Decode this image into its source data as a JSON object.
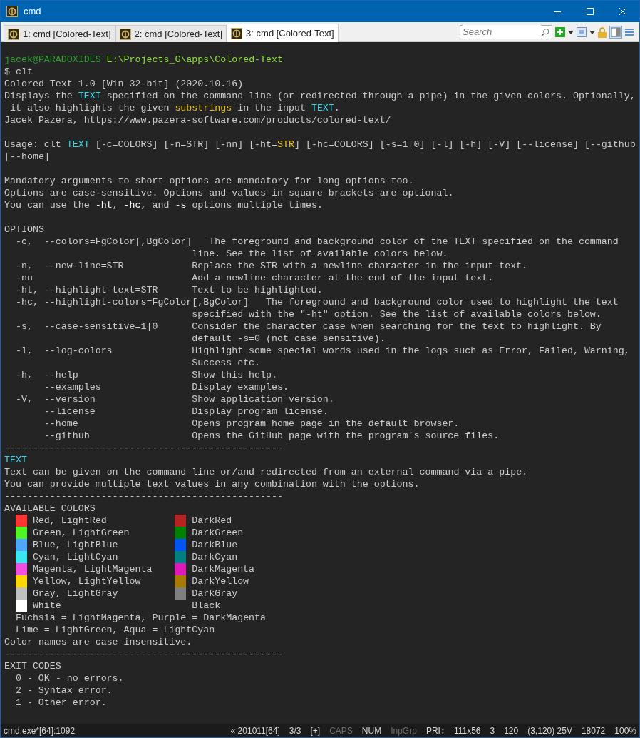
{
  "window": {
    "title": "cmd"
  },
  "tabs": [
    {
      "label": "1: cmd [Colored-Text]",
      "selected": false
    },
    {
      "label": "2: cmd [Colored-Text]",
      "selected": false
    },
    {
      "label": "3: cmd [Colored-Text]",
      "selected": true
    }
  ],
  "search": {
    "placeholder": "Search"
  },
  "console": {
    "lines": [
      {
        "kind": "prompt",
        "user": "jacek@PARADOXIDES",
        "path": "E:\\Projects_G\\apps\\Colored-Text"
      },
      {
        "kind": "text",
        "segments": [
          {
            "text": "$ clt"
          }
        ]
      },
      {
        "kind": "text",
        "segments": [
          {
            "text": "Colored Text 1.0 [Win 32-bit] (2020.10.16)"
          }
        ]
      },
      {
        "kind": "text",
        "segments": [
          {
            "text": "Displays the "
          },
          {
            "text": "TEXT",
            "color": "#3ad6e8"
          },
          {
            "text": " specified on the command line (or redirected through a pipe) in the given colors. Optionally,"
          }
        ]
      },
      {
        "kind": "text",
        "segments": [
          {
            "text": " it also highlights the given "
          },
          {
            "text": "substrings",
            "color": "#e8c11a"
          },
          {
            "text": " in the input "
          },
          {
            "text": "TEXT",
            "color": "#3ad6e8"
          },
          {
            "text": "."
          }
        ]
      },
      {
        "kind": "text",
        "segments": [
          {
            "text": "Jacek Pazera, https://www.pazera-software.com/products/colored-text/"
          }
        ]
      },
      {
        "kind": "blank"
      },
      {
        "kind": "text",
        "segments": [
          {
            "text": "Usage: clt "
          },
          {
            "text": "TEXT",
            "color": "#3ad6e8"
          },
          {
            "text": " [-c=COLORS] [-n=STR] [-nn] [-ht="
          },
          {
            "text": "STR",
            "color": "#e8c11a"
          },
          {
            "text": "] [-hc=COLORS] [-s=1|0] [-l] [-h] [-V] [--license] [--github"
          }
        ]
      },
      {
        "kind": "text",
        "segments": [
          {
            "text": "[--home]"
          }
        ]
      },
      {
        "kind": "blank"
      },
      {
        "kind": "text",
        "segments": [
          {
            "text": "Mandatory arguments to short options are mandatory for long options too."
          }
        ]
      },
      {
        "kind": "text",
        "segments": [
          {
            "text": "Options are case-sensitive. Options and values in square brackets are optional."
          }
        ]
      },
      {
        "kind": "text",
        "segments": [
          {
            "text": "You can use the "
          },
          {
            "text": "-ht",
            "color": "#ffffff"
          },
          {
            "text": ", "
          },
          {
            "text": "-hc",
            "color": "#ffffff"
          },
          {
            "text": ", and "
          },
          {
            "text": "-s",
            "color": "#ffffff"
          },
          {
            "text": " options multiple times."
          }
        ]
      },
      {
        "kind": "blank"
      },
      {
        "kind": "text",
        "segments": [
          {
            "text": "OPTIONS"
          }
        ]
      },
      {
        "kind": "option",
        "short": "-c,",
        "long": "--colors=FgColor[,BgColor]",
        "description": [
          "The foreground and background color of the TEXT specified on the command",
          "line. See the list of available colors below."
        ]
      },
      {
        "kind": "option",
        "short": "-n,",
        "long": "--new-line=STR",
        "description": [
          "Replace the STR with a newline character in the input text."
        ]
      },
      {
        "kind": "option",
        "short": "-nn",
        "description": [
          "Add a newline character at the end of the input text."
        ]
      },
      {
        "kind": "option",
        "short": "-ht,",
        "long": "--highlight-text=STR",
        "description": [
          "Text to be highlighted."
        ]
      },
      {
        "kind": "option",
        "short": "-hc,",
        "long": "--highlight-colors=FgColor[,BgColor]",
        "description": [
          "The foreground and background color used to highlight the text",
          "specified with the \"-ht\" option. See the list of available colors below."
        ]
      },
      {
        "kind": "option",
        "short": "-s,",
        "long": "--case-sensitive=1|0",
        "description": [
          "Consider the character case when searching for the text to highlight. By",
          "default -s=0 (not case sensitive)."
        ]
      },
      {
        "kind": "option",
        "short": "-l,",
        "long": "--log-colors",
        "description": [
          "Highlight some special words used in the logs such as Error, Failed, Warning,",
          "Success etc."
        ]
      },
      {
        "kind": "option",
        "short": "-h,",
        "long": "--help",
        "description": [
          "Show this help."
        ]
      },
      {
        "kind": "option",
        "long": "--examples",
        "description": [
          "Display examples."
        ]
      },
      {
        "kind": "option",
        "short": "-V,",
        "long": "--version",
        "description": [
          "Show application version."
        ]
      },
      {
        "kind": "option",
        "long": "--license",
        "description": [
          "Display program license."
        ]
      },
      {
        "kind": "option",
        "long": "--home",
        "description": [
          "Opens program home page in the default browser."
        ]
      },
      {
        "kind": "option",
        "long": "--github",
        "description": [
          "Opens the GitHub page with the program's source files."
        ]
      },
      {
        "kind": "rule",
        "text": "-------------------------------------------------"
      },
      {
        "kind": "text",
        "segments": [
          {
            "text": "TEXT",
            "color": "#3ad6e8"
          }
        ]
      },
      {
        "kind": "text",
        "segments": [
          {
            "text": "Text can be given on the command line or/and redirected from an external command via a pipe."
          }
        ]
      },
      {
        "kind": "text",
        "segments": [
          {
            "text": "You can provide multiple text values in any combination with the options."
          }
        ]
      },
      {
        "kind": "rule",
        "text": "-------------------------------------------------"
      },
      {
        "kind": "text",
        "segments": [
          {
            "text": "AVAILABLE COLORS"
          }
        ]
      },
      {
        "kind": "swatches",
        "items": [
          {
            "name": "Red, LightRed",
            "color": "#ff3434"
          },
          {
            "name": "DarkRed",
            "color": "#b62323"
          }
        ]
      },
      {
        "kind": "swatches",
        "items": [
          {
            "name": "Green, LightGreen",
            "color": "#50f524"
          },
          {
            "name": "DarkGreen",
            "color": "#008000"
          }
        ]
      },
      {
        "kind": "swatches",
        "items": [
          {
            "name": "Blue, LightBlue",
            "color": "#4ea6ff"
          },
          {
            "name": "DarkBlue",
            "color": "#0055f5"
          }
        ]
      },
      {
        "kind": "swatches",
        "items": [
          {
            "name": "Cyan, LightCyan",
            "color": "#3ae6f0"
          },
          {
            "name": "DarkCyan",
            "color": "#008080"
          }
        ]
      },
      {
        "kind": "swatches",
        "items": [
          {
            "name": "Magenta, LightMagenta",
            "color": "#f34ee0"
          },
          {
            "name": "DarkMagenta",
            "color": "#e01ab8"
          }
        ]
      },
      {
        "kind": "swatches",
        "items": [
          {
            "name": "Yellow, LightYellow",
            "color": "#fcd800"
          },
          {
            "name": "DarkYellow",
            "color": "#a67c00"
          }
        ]
      },
      {
        "kind": "swatches",
        "items": [
          {
            "name": "Gray, LightGray",
            "color": "#c0c0c0"
          },
          {
            "name": "DarkGray",
            "color": "#808080"
          }
        ]
      },
      {
        "kind": "swatches",
        "items": [
          {
            "name": "White",
            "color": "#ffffff"
          },
          {
            "name": "Black"
          }
        ]
      },
      {
        "kind": "indented",
        "text": "Fuchsia = LightMagenta, Purple = DarkMagenta"
      },
      {
        "kind": "indented",
        "text": "Lime = LightGreen, Aqua = LightCyan"
      },
      {
        "kind": "text",
        "segments": [
          {
            "text": "Color names are case insensitive."
          }
        ]
      },
      {
        "kind": "rule",
        "text": "-------------------------------------------------"
      },
      {
        "kind": "text",
        "segments": [
          {
            "text": "EXIT CODES"
          }
        ]
      },
      {
        "kind": "indented",
        "text": "0 - OK - no errors."
      },
      {
        "kind": "indented",
        "text": "2 - Syntax error."
      },
      {
        "kind": "indented",
        "text": "1 - Other error."
      }
    ]
  },
  "status_bar": {
    "process": "cmd.exe*[64]:1092",
    "items": [
      {
        "text": "« 201011[64]",
        "on": true
      },
      {
        "text": "3/3",
        "on": true
      },
      {
        "text": "[+]",
        "on": true
      },
      {
        "text": "CAPS",
        "on": false
      },
      {
        "text": "NUM",
        "on": true
      },
      {
        "text": "InpGrp",
        "on": false
      },
      {
        "text": "PRI↕",
        "on": true
      },
      {
        "text": "111x56",
        "on": true
      },
      {
        "text": "3",
        "on": true
      },
      {
        "text": "120",
        "on": true
      },
      {
        "text": "(3,120) 25V",
        "on": true
      },
      {
        "text": "18072",
        "on": true
      },
      {
        "text": "100%",
        "on": true
      }
    ]
  }
}
